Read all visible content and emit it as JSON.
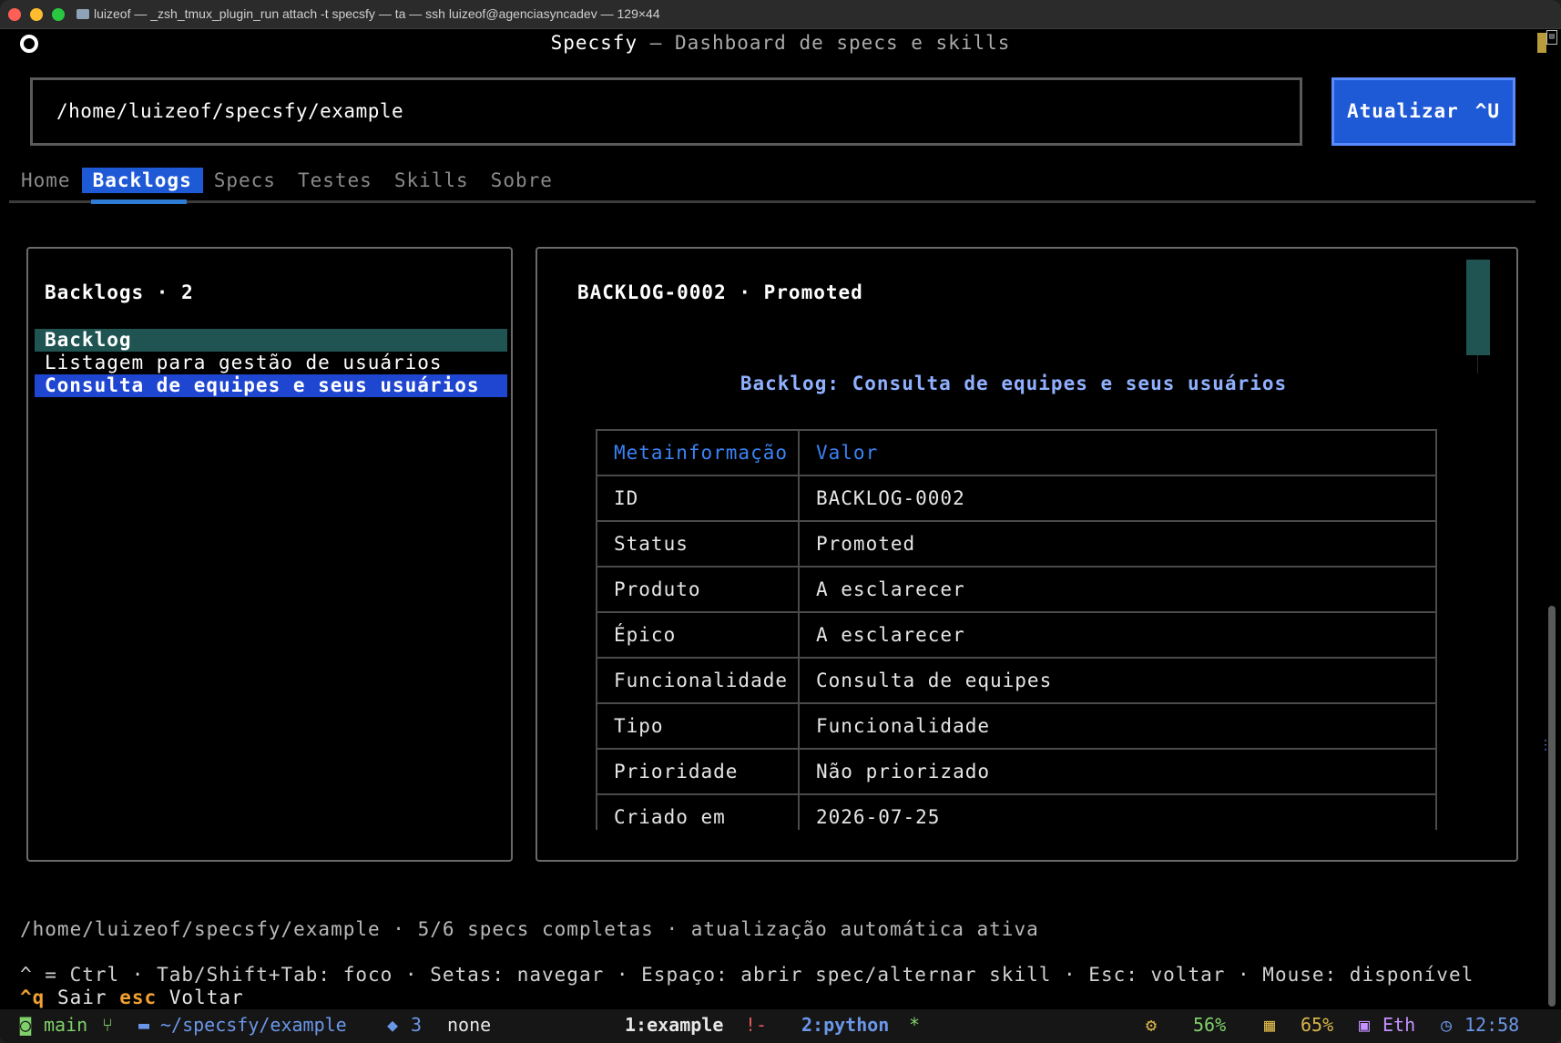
{
  "window": {
    "title": "luizeof — _zsh_tmux_plugin_run attach -t specsfy — ta — ssh luizeof@agenciasyncadev — 129×44"
  },
  "app": {
    "name": "Specsfy",
    "subtitle": " — Dashboard de specs e skills"
  },
  "toolbar": {
    "path_value": "/home/luizeof/specsfy/example",
    "refresh_label": "Atualizar",
    "refresh_hint": "^U"
  },
  "tabs": [
    {
      "label": "Home",
      "active": false
    },
    {
      "label": "Backlogs",
      "active": true
    },
    {
      "label": "Specs",
      "active": false
    },
    {
      "label": "Testes",
      "active": false
    },
    {
      "label": "Skills",
      "active": false
    },
    {
      "label": "Sobre",
      "active": false
    }
  ],
  "list_panel": {
    "title": "Backlogs · 2",
    "items": [
      {
        "label": "Backlog",
        "kind": "header"
      },
      {
        "label": "Listagem para gestão de usuários",
        "kind": "item"
      },
      {
        "label": "Consulta de equipes e seus usuários",
        "kind": "selected"
      }
    ]
  },
  "detail_panel": {
    "title": "BACKLOG-0002 · Promoted",
    "heading": "Backlog: Consulta de equipes e seus usuários",
    "columns": [
      "Metainformação",
      "Valor"
    ],
    "rows": [
      [
        "ID",
        "BACKLOG-0002"
      ],
      [
        "Status",
        "Promoted"
      ],
      [
        "Produto",
        "A esclarecer"
      ],
      [
        "Épico",
        "A esclarecer"
      ],
      [
        "Funcionalidade",
        "Consulta de equipes"
      ],
      [
        "Tipo",
        "Funcionalidade"
      ],
      [
        "Prioridade",
        "Não priorizado"
      ],
      [
        "Criado em",
        "2026-07-25"
      ]
    ]
  },
  "status_line": "/home/luizeof/specsfy/example · 5/6 specs completas · atualização automática ativa",
  "help_line": "^ = Ctrl  ·  Tab/Shift+Tab: foco  ·  Setas: navegar  ·  Espaço: abrir spec/alternar skill  ·  Esc: voltar  ·  Mouse: disponível",
  "keys": {
    "quit_key": "^q",
    "quit_label": "Sair",
    "back_key": "esc",
    "back_label": "Voltar"
  },
  "tmux": {
    "branch": "main",
    "path": "~/specsfy/example",
    "docker_count": "3",
    "env": "none",
    "window1": "1:example",
    "window1_flag": "!-",
    "window2": "2:python",
    "window2_flag": "*",
    "cpu": "56%",
    "mem": "65%",
    "net": "Eth",
    "time": "12:58"
  },
  "colors": {
    "accent": "#1f5ad6",
    "header_row": "#1f5452",
    "table_header": "#3b82f6",
    "detail_heading": "#8fb0ff",
    "key_highlight": "#f0a030"
  }
}
